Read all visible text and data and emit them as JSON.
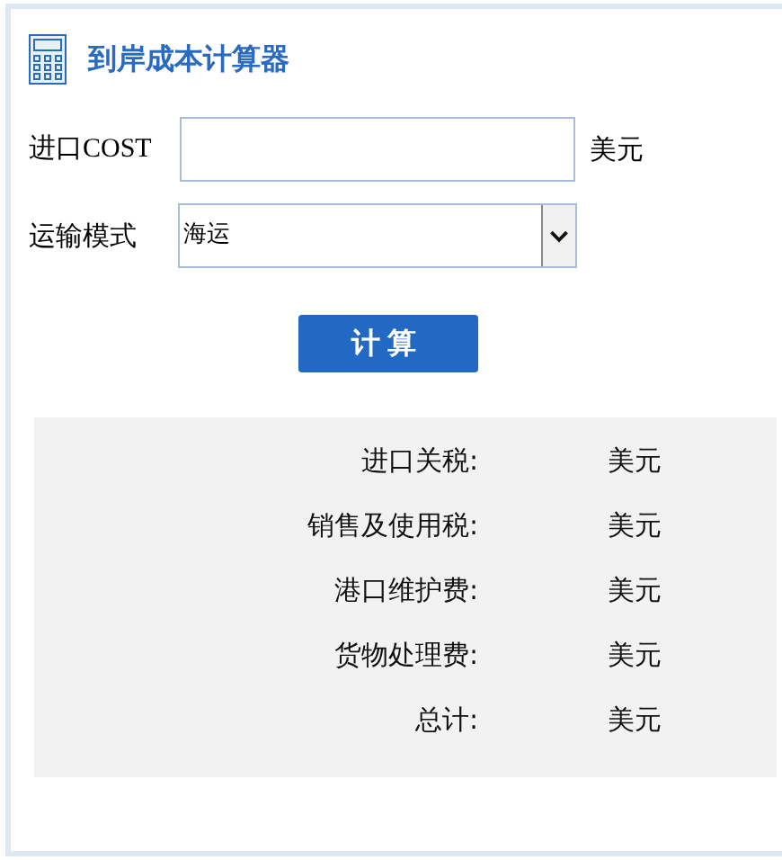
{
  "title": "到岸成本计算器",
  "cost_field": {
    "label": "进口COST",
    "unit": "美元"
  },
  "shipping_mode": {
    "label": "运输模式",
    "value": "海运"
  },
  "calculate_button": "计算",
  "results": [
    {
      "label": "进口关税:",
      "unit": "美元"
    },
    {
      "label": "销售及使用税:",
      "unit": "美元"
    },
    {
      "label": "港口维护费:",
      "unit": "美元"
    },
    {
      "label": "货物处理费:",
      "unit": "美元"
    },
    {
      "label": "总计:",
      "unit": "美元"
    }
  ]
}
